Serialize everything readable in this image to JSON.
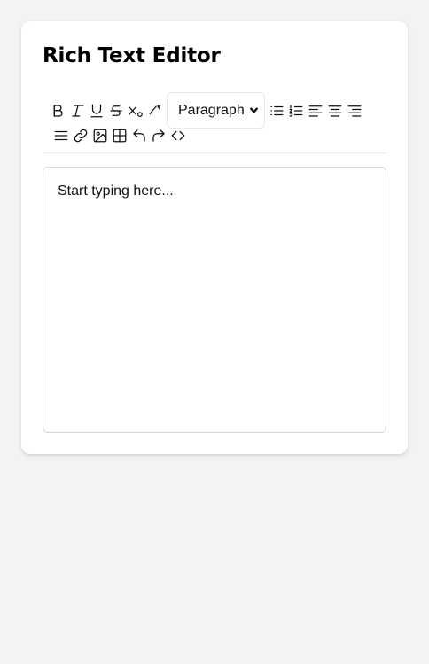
{
  "editor_card": {
    "title": "Rich Text Editor"
  },
  "toolbar": {
    "buttons_row1_left": [
      "bold-icon",
      "italic-icon",
      "underline-icon",
      "strikethrough-icon",
      "subscript-icon",
      "clear-format-icon"
    ],
    "block_format": {
      "selected": "Paragraph"
    },
    "buttons_row1_right": [
      "bullet-list-icon",
      "numbered-list-icon",
      "align-left-icon",
      "align-center-icon",
      "align-right-icon"
    ],
    "buttons_row2": [
      "align-justify-icon",
      "link-icon",
      "image-icon",
      "table-icon",
      "undo-icon",
      "redo-icon",
      "code-view-icon"
    ]
  },
  "content": {
    "text": "Start typing here..."
  }
}
